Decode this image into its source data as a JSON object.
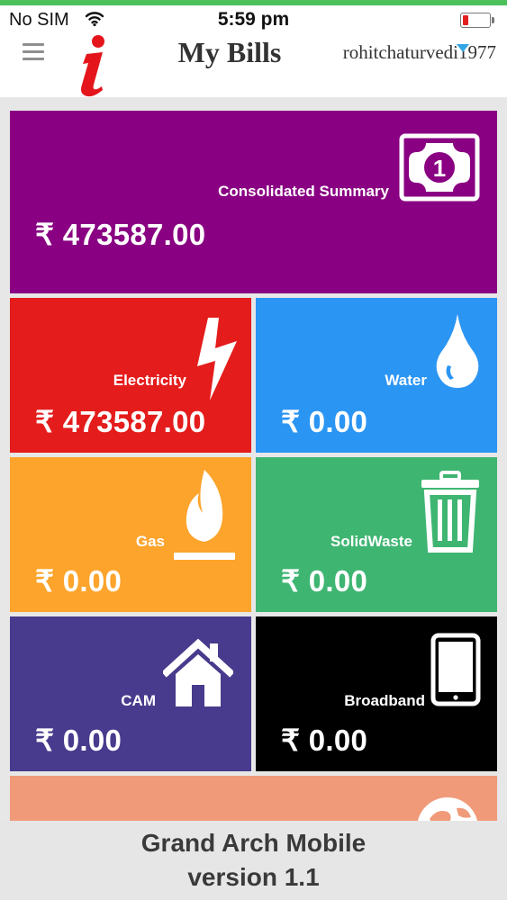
{
  "status_bar": {
    "carrier": "No SIM",
    "time": "5:59 pm",
    "battery_level": 0.15
  },
  "header": {
    "title": "My Bills",
    "username": "rohitchaturvedi1977"
  },
  "colors": {
    "consolidated": "#890082",
    "electricity": "#e41c1c",
    "water": "#2b95f3",
    "gas": "#fca42c",
    "solidwaste": "#3fb572",
    "cam": "#483b8d",
    "broadband": "#000000",
    "next": "#f09a7a"
  },
  "tiles": {
    "consolidated": {
      "label": "Consolidated Summary",
      "amount": "₹ 473587.00",
      "icon": "banknote-icon"
    },
    "electricity": {
      "label": "Electricity",
      "amount": "₹ 473587.00",
      "icon": "lightning-icon"
    },
    "water": {
      "label": "Water",
      "amount": "₹ 0.00",
      "icon": "water-drop-icon"
    },
    "gas": {
      "label": "Gas",
      "amount": "₹ 0.00",
      "icon": "flame-icon"
    },
    "solidwaste": {
      "label": "SolidWaste",
      "amount": "₹ 0.00",
      "icon": "trash-icon"
    },
    "cam": {
      "label": "CAM",
      "amount": "₹ 0.00",
      "icon": "home-icon"
    },
    "broadband": {
      "label": "Broadband",
      "amount": "₹ 0.00",
      "icon": "tablet-icon"
    },
    "next": {
      "icon": "globe-icon"
    }
  },
  "footer": {
    "line1": "Grand Arch Mobile",
    "line2": "version 1.1"
  }
}
